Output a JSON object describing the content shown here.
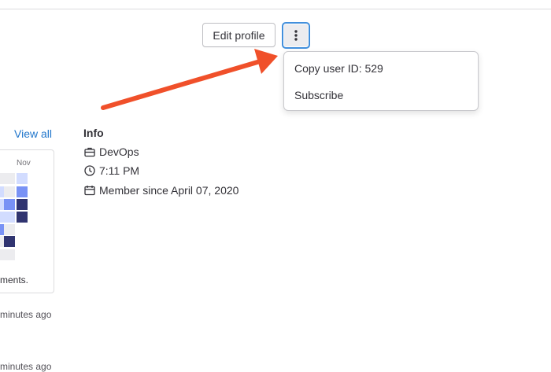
{
  "header": {
    "edit_profile_label": "Edit profile",
    "more_actions_icon": "kebab-vertical-icon"
  },
  "dropdown": {
    "items": [
      {
        "label": "Copy user ID: 529"
      },
      {
        "label": "Subscribe"
      }
    ]
  },
  "annotation": {
    "arrow_color": "#f0502a"
  },
  "activity": {
    "view_all_label": "View all",
    "month_label": "Nov",
    "legend_note": "ments.",
    "events": [
      {
        "time": "minutes ago"
      },
      {
        "time": "minutes ago"
      }
    ]
  },
  "info": {
    "heading": "Info",
    "organization": "DevOps",
    "local_time": "7:11 PM",
    "member_since": "Member since April 07, 2020"
  },
  "colors": {
    "link": "#1f75cb",
    "focus_ring": "#428fdc",
    "level_empty": "#ececef",
    "level_1": "#d2dcff",
    "level_2": "#7992f5",
    "level_3": "#303470"
  }
}
